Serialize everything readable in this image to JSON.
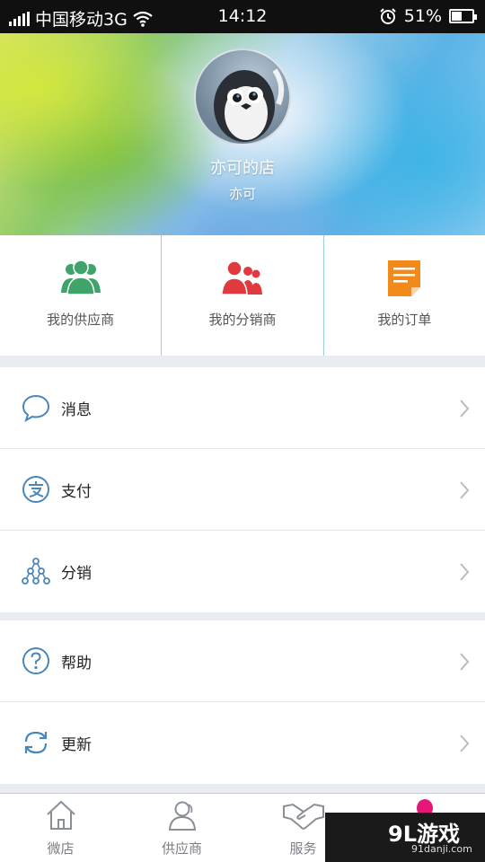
{
  "status_bar": {
    "carrier": "中国移动3G",
    "time": "14:12",
    "battery": "51%",
    "battery_level": 0.51
  },
  "profile": {
    "shop_name": "亦可的店",
    "user_name": "亦可"
  },
  "quick_actions": [
    {
      "label": "我的供应商",
      "icon": "suppliers-icon",
      "color": "#3fa36a"
    },
    {
      "label": "我的分销商",
      "icon": "distributors-icon",
      "color": "#e0393e"
    },
    {
      "label": "我的订单",
      "icon": "orders-icon",
      "color": "#f28a1a"
    }
  ],
  "menu_group1": [
    {
      "label": "消息",
      "icon": "message-icon"
    },
    {
      "label": "支付",
      "icon": "alipay-icon"
    },
    {
      "label": "分销",
      "icon": "distribution-tree-icon"
    }
  ],
  "menu_group2": [
    {
      "label": "帮助",
      "icon": "help-icon"
    },
    {
      "label": "更新",
      "icon": "refresh-icon"
    }
  ],
  "tabs": [
    {
      "label": "微店",
      "icon": "home-icon"
    },
    {
      "label": "供应商",
      "icon": "user-icon"
    },
    {
      "label": "服务",
      "icon": "handshake-icon"
    }
  ],
  "watermark": {
    "logo": "9L游戏",
    "url": "91danji.com"
  },
  "colors": {
    "icon_blue": "#4a86b8",
    "tab_gray": "#8a8f95",
    "accent_pink": "#e6167a"
  }
}
